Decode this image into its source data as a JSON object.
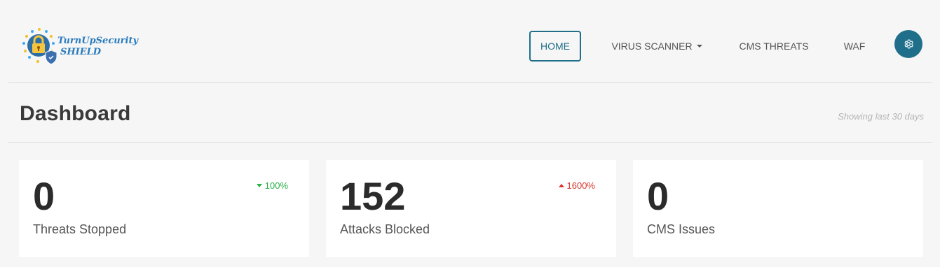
{
  "brand": {
    "line1": "TurnUpSecurity",
    "line2": "SHIELD",
    "logo_icon": "padlock-shield-icon",
    "color": "#2a7bbd"
  },
  "nav": {
    "home": "HOME",
    "virus_scanner": "VIRUS SCANNER",
    "cms_threats": "CMS THREATS",
    "waf": "WAF",
    "settings_icon": "gear-icon",
    "accent_color": "#1f6f8b"
  },
  "dashboard": {
    "title": "Dashboard",
    "range_note": "Showing last 30 days"
  },
  "cards": [
    {
      "value": "0",
      "label": "Threats Stopped",
      "trend": "100%",
      "trend_direction": "down",
      "trend_color": "#27b045"
    },
    {
      "value": "152",
      "label": "Attacks Blocked",
      "trend": "1600%",
      "trend_direction": "up",
      "trend_color": "#d9342b"
    },
    {
      "value": "0",
      "label": "CMS Issues"
    }
  ]
}
